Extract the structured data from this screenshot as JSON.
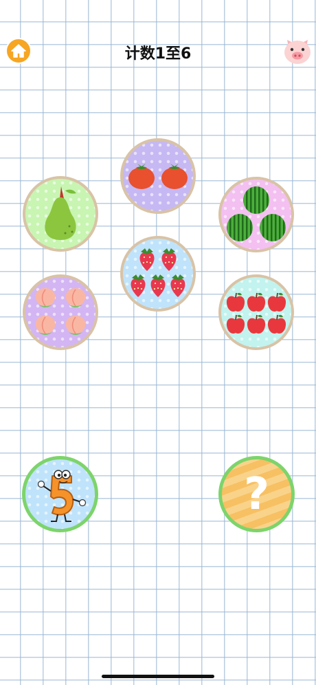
{
  "header": {
    "title": "计数1至6",
    "home_icon": "home-icon",
    "profile_icon": "pig-face-icon"
  },
  "colors": {
    "home_button": "#f6a623",
    "circle_border": "#d9c3a6",
    "answer_border": "#7dd46b",
    "grid_line": "#96b4d2"
  },
  "fruit_circles": [
    {
      "fruit": "pear",
      "count": 1,
      "bg": "green"
    },
    {
      "fruit": "tomato",
      "count": 2,
      "bg": "purple"
    },
    {
      "fruit": "watermelon",
      "count": 3,
      "bg": "pink"
    },
    {
      "fruit": "strawberry",
      "count": 5,
      "bg": "blue"
    },
    {
      "fruit": "peach",
      "count": 4,
      "bg": "lavender"
    },
    {
      "fruit": "apple",
      "count": 6,
      "bg": "cyan"
    }
  ],
  "bottom": {
    "number_card": {
      "label": "5",
      "icon": "number-five-character-icon"
    },
    "mystery_card": {
      "label": "?",
      "icon": "question-mark-icon"
    }
  }
}
